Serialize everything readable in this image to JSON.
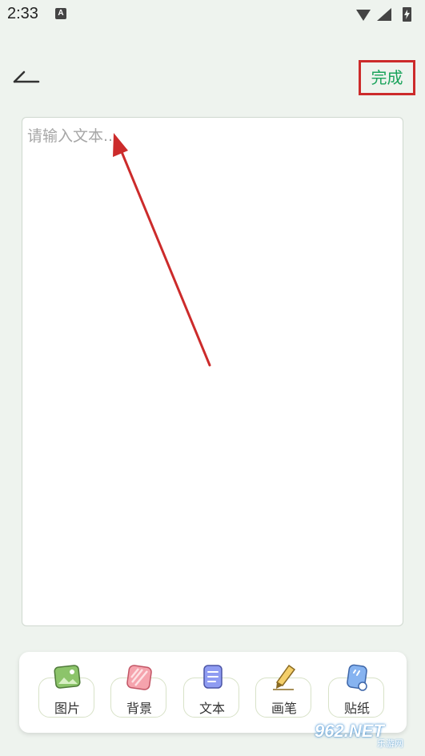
{
  "status_bar": {
    "time": "2:33",
    "notification_icon": "A"
  },
  "header": {
    "back_icon": "back-icon",
    "done_label": "完成"
  },
  "editor": {
    "placeholder": "请输入文本..."
  },
  "toolbar": {
    "items": [
      {
        "label": "图片",
        "icon": "image-icon"
      },
      {
        "label": "背景",
        "icon": "background-icon"
      },
      {
        "label": "文本",
        "icon": "text-icon"
      },
      {
        "label": "画笔",
        "icon": "brush-icon"
      },
      {
        "label": "贴纸",
        "icon": "sticker-icon"
      }
    ]
  },
  "watermark": {
    "text": "962.NET",
    "sub": "乐游网"
  },
  "colors": {
    "accent": "#1aa35b",
    "annotation_red": "#cc2b2b",
    "background": "#eef3ee"
  }
}
